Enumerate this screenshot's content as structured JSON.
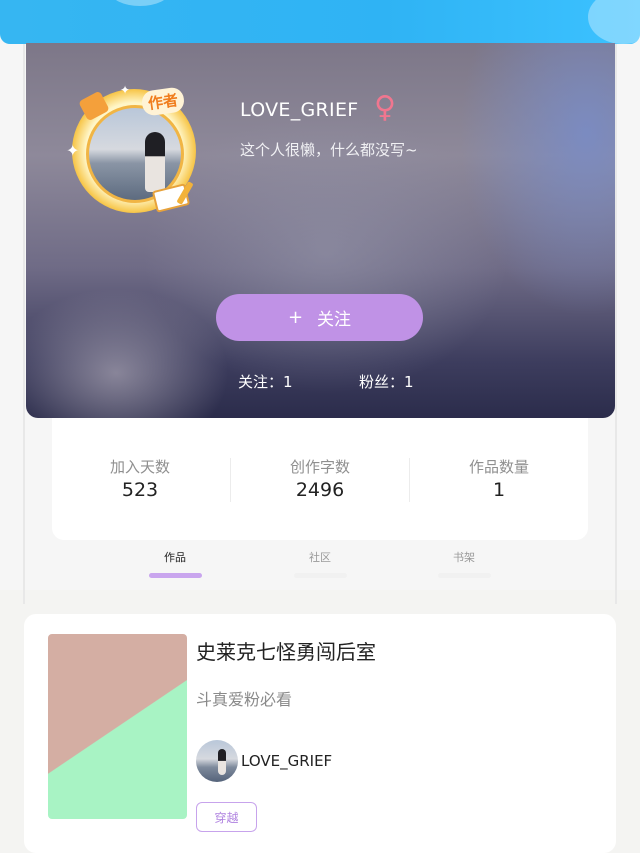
{
  "profile": {
    "username": "LOVE_GRIEF",
    "gender_symbol": "♀",
    "bio": "这个人很懒，什么都没写~",
    "author_badge": "作者",
    "follow_button": {
      "plus": "+",
      "label": "关注"
    },
    "following": "关注：1",
    "followers": "粉丝：1"
  },
  "stats": [
    {
      "label": "加入天数",
      "value": "523"
    },
    {
      "label": "创作字数",
      "value": "2496"
    },
    {
      "label": "作品数量",
      "value": "1"
    }
  ],
  "tabs": [
    {
      "label": "作品",
      "active": true
    },
    {
      "label": "社区",
      "active": false
    },
    {
      "label": "书架",
      "active": false
    }
  ],
  "works": [
    {
      "title": "史莱克七怪勇闯后室",
      "description": "斗真爱粉必看",
      "author": "LOVE_GRIEF",
      "tag": "穿越"
    }
  ],
  "colors": {
    "accent": "#c092e6",
    "banner": "#36b6f2",
    "gender": "#f0768f"
  }
}
